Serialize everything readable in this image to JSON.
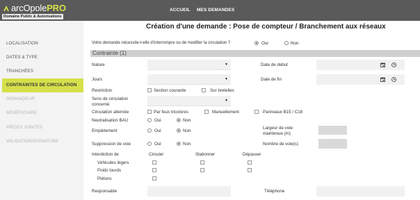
{
  "header": {
    "logo_prefix": "arcOpole",
    "logo_suffix": "PRO",
    "subtitle": "Domaine Public & Autorisations",
    "nav": [
      {
        "label": "ACCUEIL"
      },
      {
        "label": "MES DEMANDES"
      }
    ]
  },
  "sidebar": {
    "items": [
      {
        "label": "LOCALISATION",
        "state": "done"
      },
      {
        "label": "DATES & TYPE",
        "state": "done"
      },
      {
        "label": "TRANCHÉES",
        "state": "done"
      },
      {
        "label": "CONTRAINTES DE CIRCULATION",
        "state": "active"
      },
      {
        "label": "DEMANDEUR",
        "state": "disabled"
      },
      {
        "label": "BÉNÉFICIAIRE",
        "state": "disabled"
      },
      {
        "label": "PIÈCES JOINTES",
        "state": "disabled"
      },
      {
        "label": "VALIDATION/SIGNATURE",
        "state": "disabled"
      }
    ]
  },
  "main": {
    "title": "Création d'une demande : Pose de compteur / Branchement aux réseaux",
    "question": "Votre demande nécessite-t-elle d'interrompre ou de modifier la circulation ?",
    "question_yes": "Oui",
    "question_no": "Non",
    "question_value": "Oui",
    "section_title": "Contrainte (1)",
    "nature_label": "Nature",
    "nature_value": "",
    "jours_label": "Jours",
    "jours_value": "",
    "date_debut_label": "Date de debut",
    "date_fin_label": "Date de fin",
    "restriction_label": "Restriction",
    "restriction_options": [
      "Section courante",
      "Sur bretelles"
    ],
    "sens_label_1": "Sens de circulation",
    "sens_label_2": "concerné",
    "sens_value": "",
    "alternee_label": "Circulation alternée",
    "alternee_options": [
      "Par feux tricolores",
      "Manuellement",
      "Panneaux B15 / C18"
    ],
    "bau_label": "Neutralisation BAU",
    "emp_label": "Empiètement",
    "supp_label": "Suppression de voie",
    "oui": "Oui",
    "non": "Non",
    "bau_value": "Non",
    "emp_value": "Non",
    "supp_value": "Non",
    "largeur_label_1": "Largeur de voie",
    "largeur_label_2": "maintenue (m)",
    "nb_voies_label": "Nombre de voie(s)",
    "interdiction_label": "Interdiction de",
    "interdiction_cols": [
      "Circuler",
      "Stationner",
      "Dépasser"
    ],
    "interdiction_rows": [
      "Véhicules légers",
      "Poids lourds",
      "Piétons"
    ],
    "responsable_label": "Responsable",
    "telephone_label": "Téléphone"
  },
  "colors": {
    "header_bg": "#5a5a5a",
    "accent": "#d5e04a",
    "section_bar": "#cfcfcf"
  }
}
